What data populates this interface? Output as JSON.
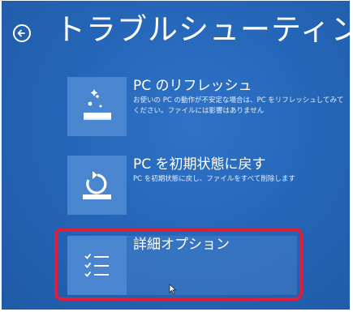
{
  "header": {
    "title": "トラブルシューティング",
    "back_icon": "back-arrow-icon"
  },
  "options": [
    {
      "icon": "refresh-pc-icon",
      "title": "PC のリフレッシュ",
      "description": "お使いの PC の動作が不安定な場合は、PC をリフレッシュしてみてください。ファイルには影響はありません"
    },
    {
      "icon": "reset-pc-icon",
      "title": "PC を初期状態に戻す",
      "description": "PC を初期状態に戻し、ファイルをすべて削除します"
    },
    {
      "icon": "advanced-options-icon",
      "title": "詳細オプション",
      "description": ""
    }
  ],
  "colors": {
    "background": "#2566b8",
    "tile": "#4a86cf",
    "highlight": "#e01e3c",
    "text": "#ffffff"
  }
}
